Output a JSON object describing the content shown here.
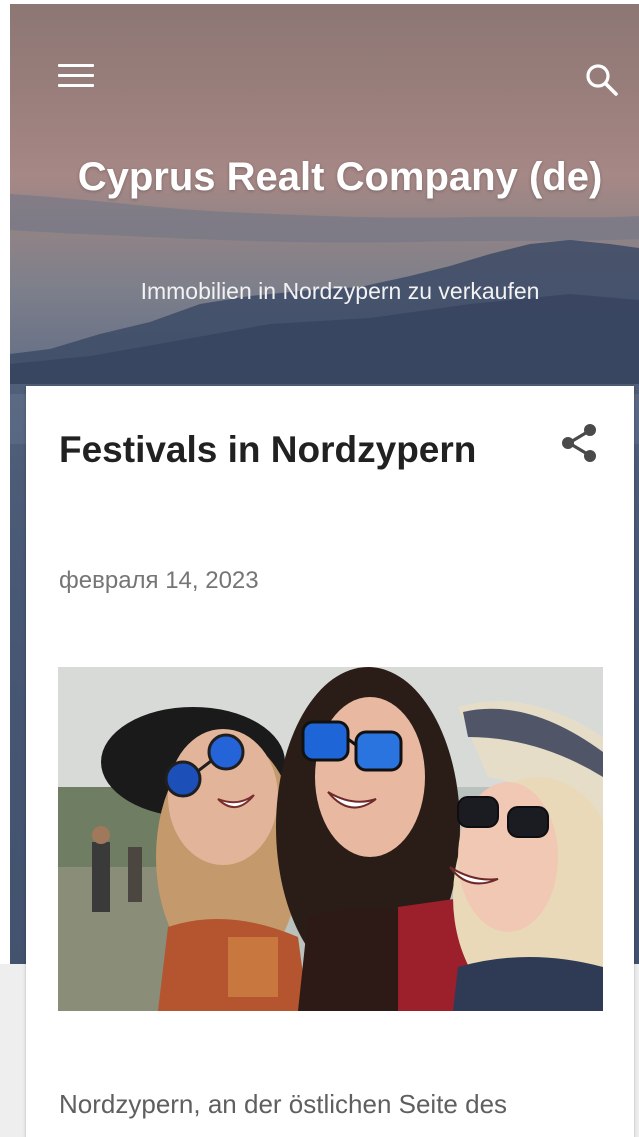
{
  "header": {
    "menu_icon": "hamburger-menu-icon",
    "search_icon": "search-icon",
    "site_title": "Cyprus Realt Company (de)",
    "site_description": "Immobilien in Nordzypern zu verkaufen"
  },
  "post": {
    "title": "Festivals in Nordzypern",
    "share_icon": "share-icon",
    "date": "февраля 14, 2023",
    "image_alt": "Three laughing young women wearing sunglasses at a festival",
    "snippet": "Nordzypern, an der östlichen Seite des"
  },
  "colors": {
    "title_text": "#212121",
    "date_text": "#757575",
    "body_text": "#5f5f5f",
    "hero_overlay": "#52617c",
    "card_bg": "#ffffff",
    "page_bg": "#eeeeee"
  }
}
